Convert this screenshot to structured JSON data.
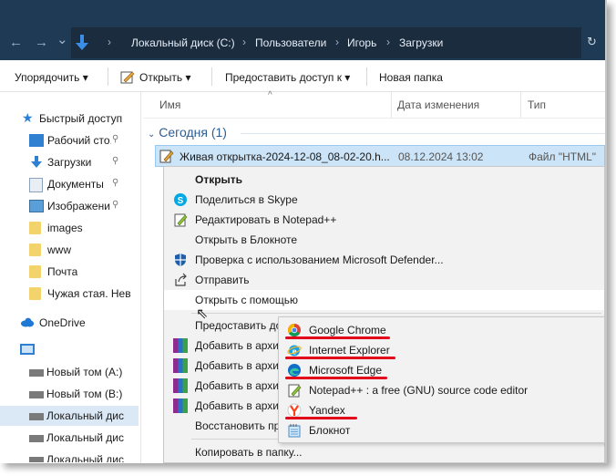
{
  "address": {
    "crumbs": [
      "Локальный диск (C:)",
      "Пользователи",
      "Игорь",
      "Загрузки"
    ],
    "back_glyph": "←",
    "forward_glyph": "→",
    "dropdown_glyph": "⌄",
    "sep_glyph": "›",
    "refresh_glyph": "↻"
  },
  "toolbar": {
    "organize": "Упорядочить ▾",
    "open": "Открыть ▾",
    "share": "Предоставить доступ к ▾",
    "new_folder": "Новая папка"
  },
  "nav": {
    "quick_access": "Быстрый доступ",
    "items": [
      {
        "label": "Рабочий сто...",
        "icon": "desktop-icon"
      },
      {
        "label": "Загрузки",
        "icon": "downloads-icon"
      },
      {
        "label": "Документы",
        "icon": "documents-icon"
      },
      {
        "label": "Изображени",
        "icon": "pictures-icon"
      },
      {
        "label": "images",
        "icon": "folder-icon"
      },
      {
        "label": "www",
        "icon": "folder-icon"
      },
      {
        "label": "Почта",
        "icon": "folder-icon"
      },
      {
        "label": "Чужая стая. Нев",
        "icon": "folder-icon"
      }
    ],
    "onedrive": "OneDrive",
    "drives": [
      "Новый том (A:)",
      "Новый том (B:)",
      "Локальный дис",
      "Локальный дис",
      "Локальный дис"
    ],
    "pin_glyph": "📌"
  },
  "columns": {
    "name": "Имя",
    "date": "Дата изменения",
    "type": "Тип"
  },
  "group": "Сегодня (1)",
  "file": {
    "name": "Живая открытка-2024-12-08_08-02-20.h...",
    "date": "08.12.2024 13:02",
    "type": "Файл \"HTML\""
  },
  "context_menu": {
    "open": "Открыть",
    "skype": "Поделиться в Skype",
    "notepadpp": "Редактировать в Notepad++",
    "notepad": "Открыть в Блокноте",
    "defender": "Проверка с использованием Microsoft Defender...",
    "send": "Отправить",
    "open_with": "Открыть с помощью",
    "share_access": "Предоставить до",
    "archive1": "Добавить в архи",
    "archive2": "Добавить в архи",
    "archive3": "Добавить в архи",
    "archive4": "Добавить в архи",
    "restore": "Восстановить пр",
    "copy": "Копировать в папку..."
  },
  "submenu": {
    "items": [
      {
        "label": "Google Chrome",
        "icon": "chrome-icon"
      },
      {
        "label": "Internet Explorer",
        "icon": "ie-icon"
      },
      {
        "label": "Microsoft Edge",
        "icon": "edge-icon"
      },
      {
        "label": "Notepad++ : a free (GNU) source code editor",
        "icon": "notepadpp-icon"
      },
      {
        "label": "Yandex",
        "icon": "yandex-icon"
      },
      {
        "label": "Блокнот",
        "icon": "notepad-icon"
      }
    ]
  },
  "colors": {
    "underline": "#e2001a",
    "titlebar": "#1f3a55",
    "selection": "#cce4f7"
  }
}
